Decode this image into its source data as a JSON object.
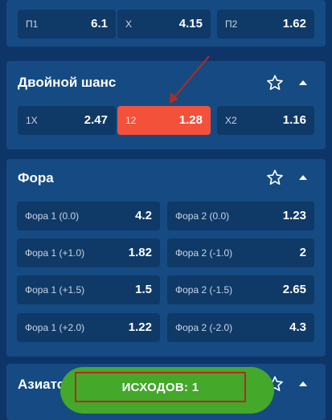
{
  "top_row": [
    {
      "label": "П1",
      "value": "6.1"
    },
    {
      "label": "X",
      "value": "4.15"
    },
    {
      "label": "П2",
      "value": "1.62"
    }
  ],
  "double_chance": {
    "title": "Двойной шанс",
    "cells": [
      {
        "label": "1X",
        "value": "2.47"
      },
      {
        "label": "12",
        "value": "1.28"
      },
      {
        "label": "X2",
        "value": "1.16"
      }
    ]
  },
  "handicap": {
    "title": "Фора",
    "rows": [
      [
        {
          "label": "Фора 1 (0.0)",
          "value": "4.2"
        },
        {
          "label": "Фора 2 (0.0)",
          "value": "1.23"
        }
      ],
      [
        {
          "label": "Фора 1 (+1.0)",
          "value": "1.82"
        },
        {
          "label": "Фора 2 (-1.0)",
          "value": "2"
        }
      ],
      [
        {
          "label": "Фора 1 (+1.5)",
          "value": "1.5"
        },
        {
          "label": "Фора 2 (-1.5)",
          "value": "2.65"
        }
      ],
      [
        {
          "label": "Фора 1 (+2.0)",
          "value": "1.22"
        },
        {
          "label": "Фора 2 (-2.0)",
          "value": "4.3"
        }
      ]
    ]
  },
  "asian": {
    "title": "Азиатс"
  },
  "bottom_button": {
    "label": "ИСХОДОВ: 1"
  },
  "colors": {
    "background": "#0d3568",
    "card": "#154b82",
    "cell": "#0f3966",
    "selected": "#f4513b",
    "button": "#44a82b",
    "annotation": "#b52a20"
  },
  "icons": [
    "star-icon",
    "chevron-up-icon",
    "annotation-arrow"
  ]
}
